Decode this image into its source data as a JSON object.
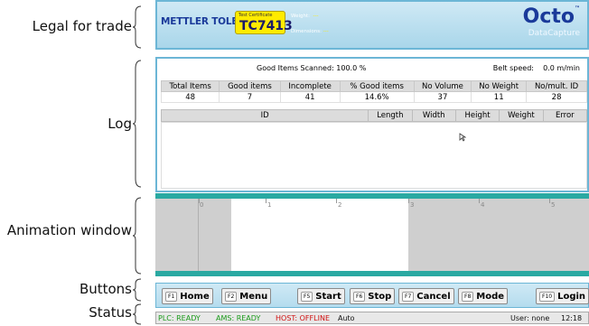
{
  "annotations": {
    "legal": "Legal for trade",
    "log": "Log",
    "animation": "Animation window",
    "buttons": "Buttons",
    "status": "Status"
  },
  "header": {
    "brand": "METTLER TOLEDO",
    "cert_caption": "Test Certificate",
    "cert_code": "TC7413",
    "weight_label": "Weight:",
    "weight_value": "---",
    "dims_label": "Dimensions:",
    "dims_value": "---",
    "product_name": "Octo",
    "product_tm": "™",
    "product_sub": "DataCapture"
  },
  "log": {
    "summary_left": "Good Items Scanned: 100.0 %",
    "summary_right_label": "Belt speed:",
    "summary_right_value": "0.0 m/min",
    "stats_headers": [
      "Total Items",
      "Good items",
      "Incomplete",
      "% Good items",
      "No Volume",
      "No Weight",
      "No/mult. ID"
    ],
    "stats_values": [
      "48",
      "7",
      "41",
      "14.6%",
      "37",
      "11",
      "28"
    ],
    "item_headers": [
      "ID",
      "Length",
      "Width",
      "Height",
      "Weight",
      "Error"
    ]
  },
  "animation": {
    "ticks": [
      "0",
      "1",
      "2",
      "3",
      "4",
      "5"
    ]
  },
  "buttons": [
    {
      "fkey": "F1",
      "label": "Home"
    },
    {
      "fkey": "F2",
      "label": "Menu"
    },
    {
      "fkey": "F5",
      "label": "Start"
    },
    {
      "fkey": "F6",
      "label": "Stop"
    },
    {
      "fkey": "F7",
      "label": "Cancel"
    },
    {
      "fkey": "F8",
      "label": "Mode"
    },
    {
      "fkey": "F10",
      "label": "Login"
    }
  ],
  "status": {
    "plc": "PLC: READY",
    "ams": "AMS: READY",
    "host": "HOST: OFFLINE",
    "mode": "Auto",
    "user": "User: none",
    "time": "12:18"
  },
  "colors": {
    "accent": "#6cb6d6",
    "belt": "#2aa9a2",
    "ok_green": "#1a9a1a",
    "error_red": "#d01010",
    "cert_yellow": "#ffeb00"
  }
}
